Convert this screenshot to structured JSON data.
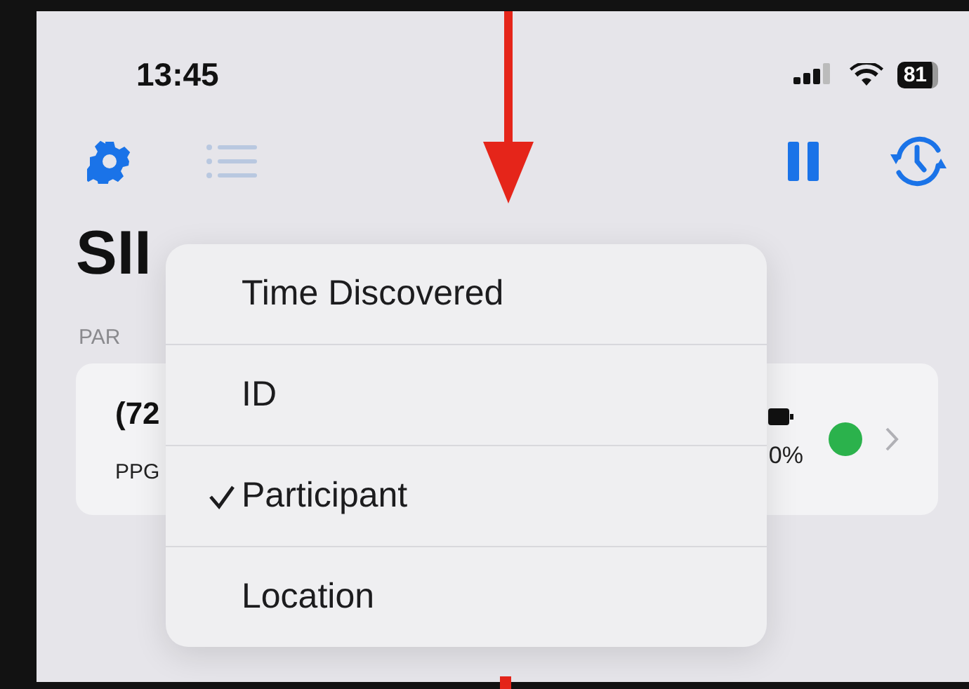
{
  "status_bar": {
    "time": "13:45",
    "battery": "81"
  },
  "title": "SII",
  "section_header": "PAR",
  "devices": [
    {
      "name": "(72",
      "subtitle": "PPG",
      "battery_reading": "0%"
    }
  ],
  "sort_menu": {
    "items": [
      {
        "label": "Time Discovered",
        "selected": false
      },
      {
        "label": "ID",
        "selected": false
      },
      {
        "label": "Participant",
        "selected": true
      },
      {
        "label": "Location",
        "selected": false
      }
    ]
  }
}
